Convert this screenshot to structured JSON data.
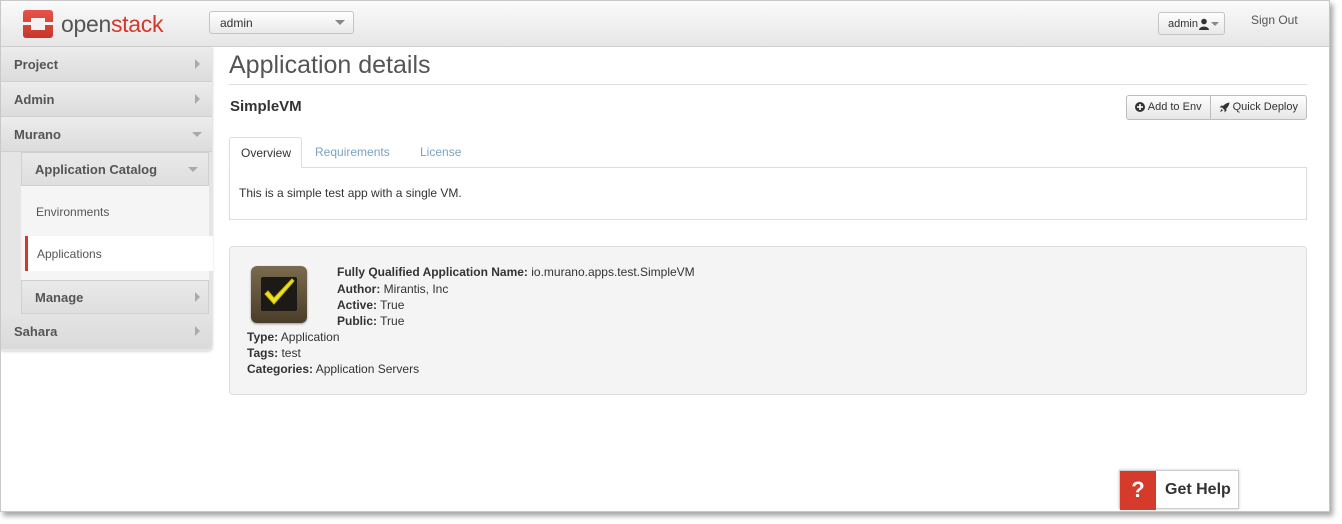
{
  "topbar": {
    "logo_text_1": "open",
    "logo_text_2": "stack",
    "project_select_value": "admin",
    "user_menu_label": "admin",
    "sign_out_label": "Sign Out"
  },
  "sidebar": {
    "dashboards": [
      "Project",
      "Admin",
      "Murano",
      "Sahara"
    ],
    "panel_group": "Application Catalog",
    "links": [
      "Environments",
      "Applications"
    ],
    "active_link": "Applications",
    "collapsed_group": "Manage"
  },
  "main": {
    "page_title": "Application details",
    "app_name": "SimpleVM",
    "buttons": {
      "add_to_env": "Add to Env",
      "quick_deploy": "Quick Deploy"
    },
    "tabs": [
      "Overview",
      "Requirements",
      "License"
    ],
    "active_tab": "Overview",
    "overview_text": "This is a simple test app with a single VM.",
    "info": {
      "fqn_label": "Fully Qualified Application Name:",
      "fqn_value": " io.murano.apps.test.SimpleVM",
      "author_label": "Author:",
      "author_value": " Mirantis, Inc",
      "active_label": "Active:",
      "active_value": " True",
      "public_label": "Public:",
      "public_value": " True",
      "type_label": "Type:",
      "type_value": " Application",
      "tags_label": "Tags:",
      "tags_value": " test",
      "categories_label": "Categories:",
      "categories_value": " Application Servers"
    }
  },
  "help": {
    "icon_text": "?",
    "label": "Get Help"
  },
  "colors": {
    "brand_red": "#d2392c",
    "link_blue": "#7aa3bf",
    "checkmark_yellow": "#f2e21a"
  },
  "icons": [
    "openstack-logo-icon",
    "chevron-down-icon",
    "user-icon",
    "chevron-right-icon",
    "plus-circle-icon",
    "rocket-icon",
    "checkmark-icon",
    "question-icon"
  ]
}
